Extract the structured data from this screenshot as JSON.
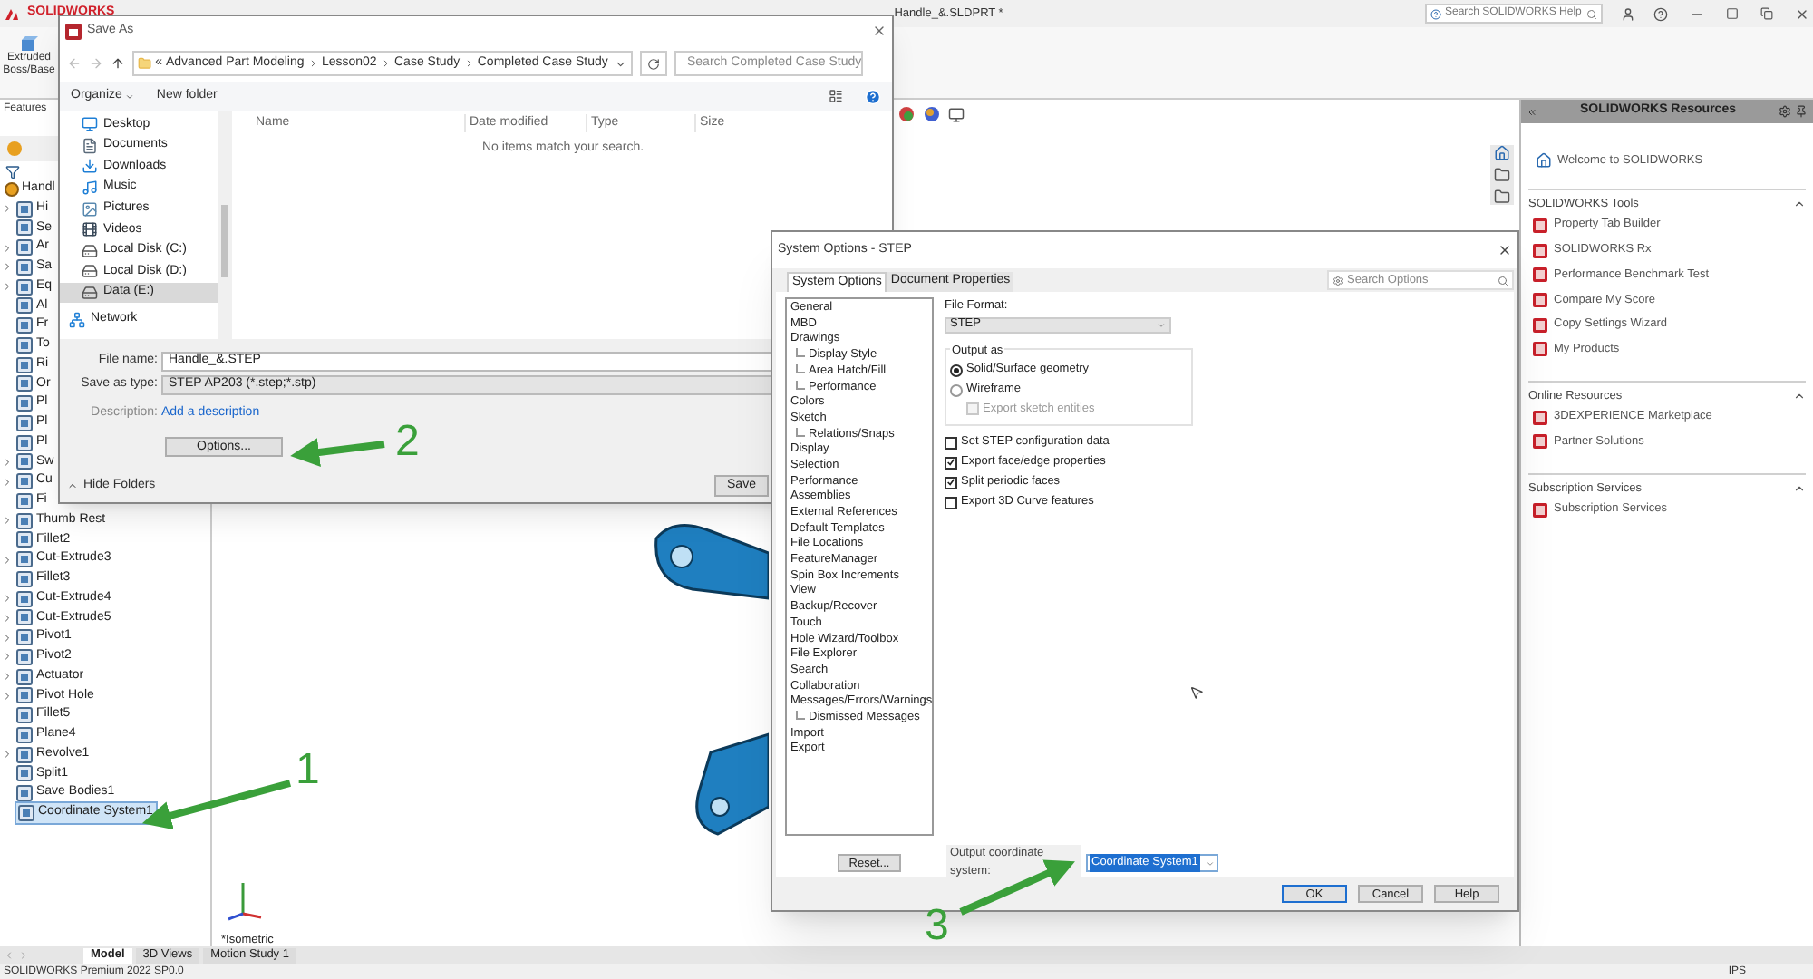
{
  "app": {
    "logo": "SOLIDWORKS",
    "document_title": "Handle_&.SLDPRT *",
    "help_search": {
      "placeholder": "Search SOLIDWORKS Help"
    }
  },
  "ribbon": {
    "command": "Extruded Boss/Base",
    "tab": "Features"
  },
  "feature_tree": {
    "label": "Handl",
    "children": [
      {
        "label": "Hi",
        "collapsed": true,
        "selected": false
      },
      {
        "label": "Se",
        "collapsed": false,
        "selected": false
      },
      {
        "label": "Ar",
        "collapsed": true,
        "selected": false
      },
      {
        "label": "Sa",
        "collapsed": true,
        "selected": false
      },
      {
        "label": "Eq",
        "collapsed": true,
        "selected": false
      },
      {
        "label": "Al",
        "collapsed": false,
        "selected": false
      },
      {
        "label": "Fr",
        "collapsed": false,
        "selected": false
      },
      {
        "label": "To",
        "collapsed": false,
        "selected": false
      },
      {
        "label": "Ri",
        "collapsed": false,
        "selected": false
      },
      {
        "label": "Or",
        "collapsed": false,
        "selected": false
      },
      {
        "label": "Pl",
        "collapsed": false,
        "selected": false
      },
      {
        "label": "Pl",
        "collapsed": false,
        "selected": false
      },
      {
        "label": "Pl",
        "collapsed": false,
        "selected": false
      },
      {
        "label": "Sw",
        "collapsed": true,
        "selected": false
      },
      {
        "label": "Cu",
        "collapsed": true,
        "selected": false
      },
      {
        "label": "Fi",
        "collapsed": false,
        "selected": false
      },
      {
        "label": "Thumb Rest",
        "collapsed": true,
        "selected": false
      },
      {
        "label": "Fillet2",
        "collapsed": false,
        "selected": false
      },
      {
        "label": "Cut-Extrude3",
        "collapsed": true,
        "selected": false
      },
      {
        "label": "Fillet3",
        "collapsed": false,
        "selected": false
      },
      {
        "label": "Cut-Extrude4",
        "collapsed": true,
        "selected": false
      },
      {
        "label": "Cut-Extrude5",
        "collapsed": true,
        "selected": false
      },
      {
        "label": "Pivot1",
        "collapsed": true,
        "selected": false
      },
      {
        "label": "Pivot2",
        "collapsed": true,
        "selected": false
      },
      {
        "label": "Actuator",
        "collapsed": true,
        "selected": false
      },
      {
        "label": "Pivot Hole",
        "collapsed": true,
        "selected": false
      },
      {
        "label": "Fillet5",
        "collapsed": false,
        "selected": false
      },
      {
        "label": "Plane4",
        "collapsed": false,
        "selected": false
      },
      {
        "label": "Revolve1",
        "collapsed": true,
        "selected": false
      },
      {
        "label": "Split1",
        "collapsed": false,
        "selected": false
      },
      {
        "label": "Save Bodies1",
        "collapsed": false,
        "selected": false
      },
      {
        "label": "Coordinate System1",
        "collapsed": false,
        "selected": true
      }
    ]
  },
  "graphics": {
    "view_label": "*Isometric"
  },
  "save_as": {
    "title": "Save As",
    "overflow_mark": "«",
    "breadcrumbs": [
      "Advanced Part Modeling",
      "Lesson02",
      "Case Study",
      "Completed Case Study"
    ],
    "search": {
      "placeholder": "Search Completed Case Study"
    },
    "organize": "Organize",
    "new_folder": "New folder",
    "nav": [
      {
        "label": "Desktop",
        "kind": "desktop",
        "selected": false
      },
      {
        "label": "Documents",
        "kind": "documents",
        "selected": false
      },
      {
        "label": "Downloads",
        "kind": "downloads",
        "selected": false
      },
      {
        "label": "Music",
        "kind": "music",
        "selected": false
      },
      {
        "label": "Pictures",
        "kind": "pictures",
        "selected": false
      },
      {
        "label": "Videos",
        "kind": "videos",
        "selected": false
      },
      {
        "label": "Local Disk (C:)",
        "kind": "drive",
        "selected": false
      },
      {
        "label": "Local Disk (D:)",
        "kind": "drive",
        "selected": false
      },
      {
        "label": "Data (E:)",
        "kind": "drive",
        "selected": true
      },
      {
        "label": "Network",
        "kind": "network",
        "selected": false
      }
    ],
    "columns": [
      "Name",
      "Date modified",
      "Type",
      "Size"
    ],
    "empty_message": "No items match your search.",
    "file_name": {
      "label": "File name:",
      "value": "Handle_&.STEP"
    },
    "save_as_type": {
      "label": "Save as type:",
      "value": "STEP AP203 (*.step;*.stp)"
    },
    "description": {
      "label": "Description:",
      "link": "Add a description"
    },
    "options_button": "Options...",
    "hide_folders": "Hide Folders",
    "save_button": "Save"
  },
  "system_options": {
    "title": "System Options - STEP",
    "tabs": [
      {
        "label": "System Options",
        "selected": true
      },
      {
        "label": "Document Properties",
        "selected": false
      }
    ],
    "search": {
      "placeholder": "Search Options"
    },
    "categories": [
      {
        "label": "General"
      },
      {
        "label": "MBD"
      },
      {
        "label": "Drawings",
        "children": [
          {
            "label": "Display Style"
          },
          {
            "label": "Area Hatch/Fill"
          },
          {
            "label": "Performance"
          }
        ]
      },
      {
        "label": "Colors"
      },
      {
        "label": "Sketch",
        "children": [
          {
            "label": "Relations/Snaps"
          }
        ]
      },
      {
        "label": "Display"
      },
      {
        "label": "Selection"
      },
      {
        "label": "Performance"
      },
      {
        "label": "Assemblies"
      },
      {
        "label": "External References"
      },
      {
        "label": "Default Templates"
      },
      {
        "label": "File Locations"
      },
      {
        "label": "FeatureManager"
      },
      {
        "label": "Spin Box Increments"
      },
      {
        "label": "View"
      },
      {
        "label": "Backup/Recover"
      },
      {
        "label": "Touch"
      },
      {
        "label": "Hole Wizard/Toolbox"
      },
      {
        "label": "File Explorer"
      },
      {
        "label": "Search"
      },
      {
        "label": "Collaboration"
      },
      {
        "label": "Messages/Errors/Warnings",
        "children": [
          {
            "label": "Dismissed Messages"
          }
        ]
      },
      {
        "label": "Import"
      },
      {
        "label": "Export"
      }
    ],
    "file_format": {
      "label": "File Format:",
      "value": "STEP"
    },
    "output_as": {
      "legend": "Output as",
      "options": [
        {
          "label": "Solid/Surface geometry",
          "selected": true
        },
        {
          "label": "Wireframe",
          "selected": false
        }
      ],
      "sub_option": {
        "label": "Export sketch entities",
        "checked": false,
        "disabled": true
      }
    },
    "checkboxes": [
      {
        "label": "Set STEP configuration data",
        "checked": false
      },
      {
        "label": "Export face/edge properties",
        "checked": true
      },
      {
        "label": "Split periodic faces",
        "checked": true
      },
      {
        "label": "Export 3D Curve features",
        "checked": false
      }
    ],
    "reset_button": "Reset...",
    "coordinate_system": {
      "label": "Output coordinate system:",
      "value": "Coordinate System1"
    },
    "buttons": [
      "OK",
      "Cancel",
      "Help"
    ]
  },
  "resources": {
    "title": "SOLIDWORKS Resources",
    "welcome": "Welcome to SOLIDWORKS",
    "sections": [
      {
        "title": "SOLIDWORKS Tools",
        "expanded": true,
        "items": [
          "Property Tab Builder",
          "SOLIDWORKS Rx",
          "Performance Benchmark Test",
          "Compare My Score",
          "Copy Settings Wizard",
          "My Products"
        ]
      },
      {
        "title": "Online Resources",
        "expanded": true,
        "items": [
          "3DEXPERIENCE Marketplace",
          "Partner Solutions"
        ]
      },
      {
        "title": "Subscription Services",
        "expanded": true,
        "items": [
          "Subscription Services"
        ]
      }
    ]
  },
  "bottom_tabs": [
    {
      "label": "Model",
      "selected": true
    },
    {
      "label": "3D Views",
      "selected": false
    },
    {
      "label": "Motion Study 1",
      "selected": false
    }
  ],
  "status_bar": {
    "product": "SOLIDWORKS Premium 2022 SP0.0",
    "units": "IPS"
  },
  "callouts": [
    {
      "label": "1"
    },
    {
      "label": "2"
    },
    {
      "label": "3"
    }
  ]
}
